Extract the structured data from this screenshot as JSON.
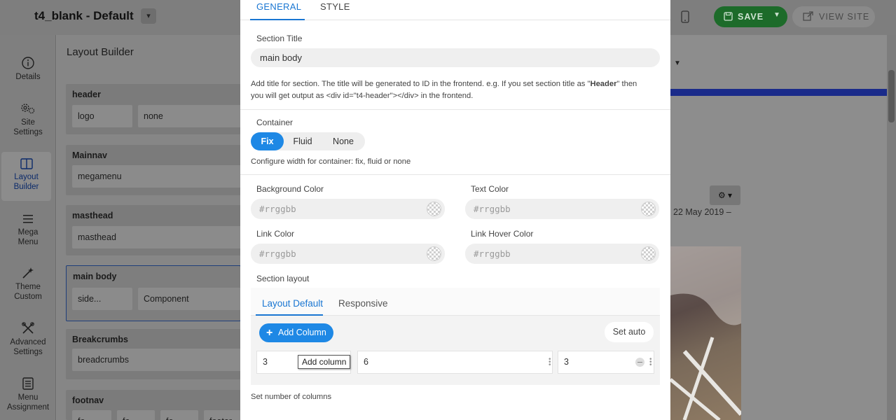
{
  "header": {
    "site_title": "t4_blank - Default",
    "save_label": "SAVE",
    "view_site_label": "VIEW SITE"
  },
  "rail": {
    "items": [
      {
        "label": "Details",
        "icon": "info-icon"
      },
      {
        "label": "Site Settings",
        "icon": "gears-icon"
      },
      {
        "label": "Layout Builder",
        "icon": "layout-icon",
        "active": true
      },
      {
        "label": "Mega Menu",
        "icon": "menu-icon"
      },
      {
        "label": "Theme Custom",
        "icon": "magic-wand-icon"
      },
      {
        "label": "Advanced Settings",
        "icon": "tools-icon"
      },
      {
        "label": "Menu Assignment",
        "icon": "list-icon"
      }
    ]
  },
  "layout_builder": {
    "title": "Layout Builder",
    "rows": [
      {
        "name": "header",
        "cells": [
          "logo",
          "none"
        ]
      },
      {
        "name": "Mainnav",
        "cells": [
          "megamenu"
        ]
      },
      {
        "name": "masthead",
        "cells": [
          "masthead"
        ]
      },
      {
        "name": "main body",
        "cells": [
          "side...",
          "Component"
        ],
        "selected": true
      },
      {
        "name": "Breakcrumbs",
        "cells": [
          "breadcrumbs"
        ]
      },
      {
        "name": "footnav",
        "cells": [
          "fo",
          "fo",
          "fo",
          "footer"
        ]
      }
    ]
  },
  "preview": {
    "date": "22 May 2019"
  },
  "modal": {
    "tabs": [
      "GENERAL",
      "STYLE"
    ],
    "section_title_label": "Section Title",
    "section_title_value": "main body",
    "section_title_help_1": "Add title for section. The title will be generated to ID in the frontend. e.g. If you set section title as \"",
    "section_title_help_bold": "Header",
    "section_title_help_2": "\" then",
    "section_title_help_line2": "you will get output as <div id=\"t4-header\"></div> in the frontend.",
    "container_label": "Container",
    "container_options": [
      "Fix",
      "Fluid",
      "None"
    ],
    "container_selected": "Fix",
    "container_help": "Configure width for container: fix, fluid or none",
    "background_color_label": "Background Color",
    "text_color_label": "Text Color",
    "link_color_label": "Link Color",
    "link_hover_color_label": "Link Hover Color",
    "color_placeholder": "#rrggbb",
    "section_layout_label": "Section layout",
    "layout_tabs": [
      "Layout Default",
      "Responsive"
    ],
    "add_column_label": "Add Column",
    "set_auto_label": "Set auto",
    "columns": [
      "3",
      "6",
      "3"
    ],
    "tooltip": "Add column",
    "columns_help": "Set number of columns"
  },
  "colors": {
    "accent": "#1e88e5",
    "save_green": "#1d6b2a"
  }
}
